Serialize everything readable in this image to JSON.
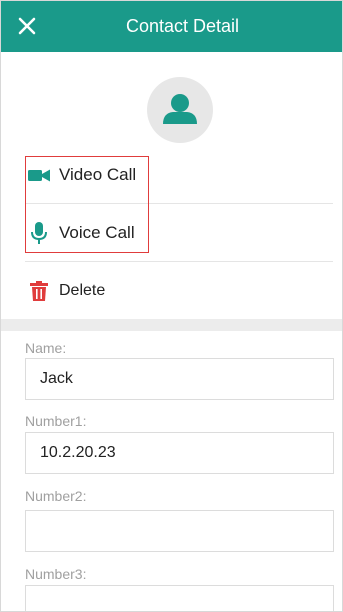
{
  "header": {
    "title": "Contact Detail",
    "close_icon": "close-icon",
    "bg_color": "#1a9a8a"
  },
  "avatar": {
    "icon": "person-icon",
    "color": "#1a9a8a"
  },
  "actions": [
    {
      "label": "Video Call",
      "icon": "video-camera-icon",
      "color": "#1a9a8a"
    },
    {
      "label": "Voice Call",
      "icon": "microphone-icon",
      "color": "#1a9a8a"
    },
    {
      "label": "Delete",
      "icon": "trash-icon",
      "color": "#e03c3c"
    }
  ],
  "highlight_color": "#e03c3c",
  "form": {
    "name": {
      "label": "Name:",
      "value": "Jack"
    },
    "number1": {
      "label": "Number1:",
      "value": "10.2.20.23"
    },
    "number2": {
      "label": "Number2:",
      "value": ""
    },
    "number3": {
      "label": "Number3:",
      "value": ""
    }
  }
}
